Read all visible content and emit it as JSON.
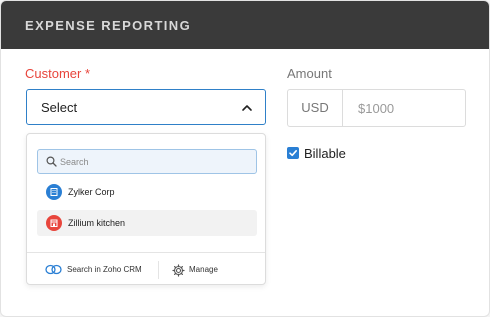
{
  "header": {
    "title": "EXPENSE REPORTING"
  },
  "customer": {
    "label": "Customer *",
    "selected": "Select",
    "dropdown": {
      "search_placeholder": "Search",
      "options": [
        {
          "name": "Zylker Corp",
          "icon": "building-icon",
          "color": "#2a7fd4"
        },
        {
          "name": "Zillium kitchen",
          "icon": "store-icon",
          "color": "#e8453c"
        }
      ],
      "footer": {
        "crm_label": "Search in Zoho CRM",
        "manage_label": "Manage"
      }
    }
  },
  "amount": {
    "label": "Amount",
    "currency": "USD",
    "placeholder": "$1000"
  },
  "billable": {
    "label": "Billable",
    "checked": true
  },
  "colors": {
    "header_bg": "#3a3a3a",
    "required_label": "#e8453c",
    "focus_border": "#2f80c8",
    "checkbox": "#2a7fd4"
  }
}
